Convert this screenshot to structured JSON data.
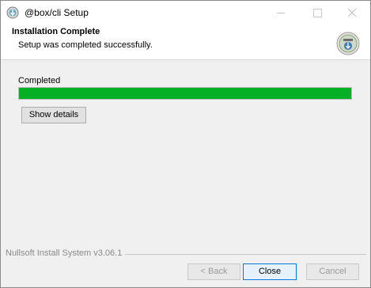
{
  "window": {
    "title": "@box/cli Setup",
    "app_icon": "installer-icon",
    "controls": [
      "minimize-icon",
      "maximize-icon",
      "close-icon"
    ]
  },
  "header": {
    "title": "Installation Complete",
    "subtitle": "Setup was completed successfully.",
    "logo": "installer-logo-icon"
  },
  "body": {
    "status_label": "Completed",
    "progress_fraction": 1.0,
    "progress_color": "#06b025",
    "show_details_label": "Show details"
  },
  "footer": {
    "branding": "Nullsoft Install System v3.06.1",
    "back_label": "< Back",
    "close_label": "Close",
    "cancel_label": "Cancel"
  }
}
